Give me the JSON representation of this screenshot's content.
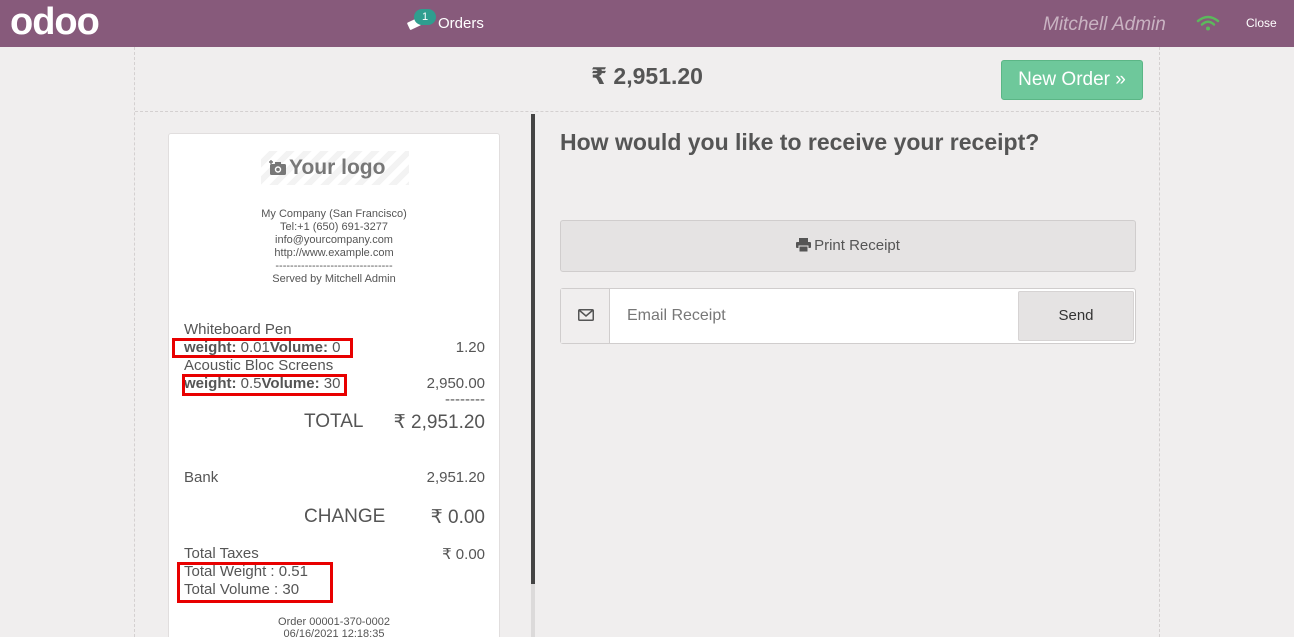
{
  "topbar": {
    "logo_text": "odoo",
    "orders_badge": "1",
    "orders_label": "Orders",
    "cashier": "Mitchell Admin",
    "close_label": "Close"
  },
  "header": {
    "total": "₹ 2,951.20",
    "new_order_label": "New Order »"
  },
  "receipt": {
    "logo_text": "Your logo",
    "company_lines": [
      "My Company (San Francisco)",
      "Tel:+1 (650) 691-3277",
      "info@yourcompany.com",
      "http://www.example.com",
      "--------------------------------",
      "Served by Mitchell Admin"
    ],
    "items": [
      {
        "name": "Whiteboard Pen",
        "weight_label": "weight:",
        "weight": " 0.01",
        "volume_label": "Volume:",
        "volume": " 0",
        "price": "1.20"
      },
      {
        "name": "Acoustic Bloc Screens",
        "weight_label": "weight:",
        "weight": " 0.5",
        "volume_label": "Volume:",
        "volume": " 30",
        "price": "2,950.00"
      }
    ],
    "separator": "--------",
    "total_label": "TOTAL",
    "total_value": "₹ 2,951.20",
    "payment_method": "Bank",
    "payment_amount": "2,951.20",
    "change_label": "CHANGE",
    "change_value": "₹ 0.00",
    "taxes_label": "Total Taxes",
    "taxes_value": "₹ 0.00",
    "total_weight": "Total Weight : 0.51",
    "total_volume": "Total Volume : 30",
    "order_ref": "Order 00001-370-0002",
    "order_date": "06/16/2021 12:18:35"
  },
  "payment": {
    "question": "How would you like to receive your receipt?",
    "print_label": "Print Receipt",
    "email_placeholder": "Email Receipt",
    "send_label": "Send"
  },
  "colors": {
    "topbar": "#875a7b",
    "new_order": "#6ec89b",
    "highlight": "#e80000"
  }
}
